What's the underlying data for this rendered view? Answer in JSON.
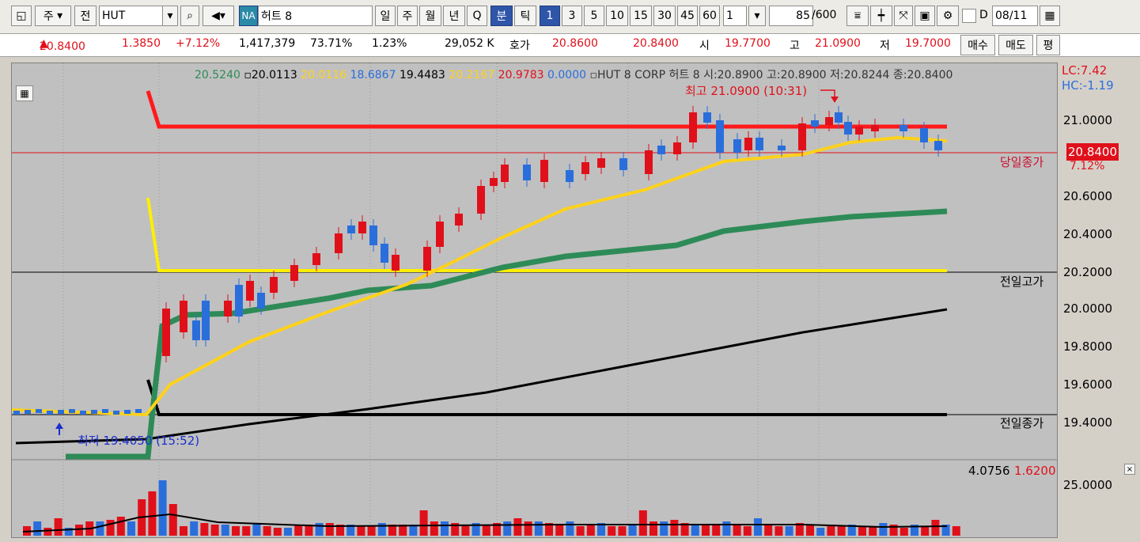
{
  "toolbar": {
    "period_label": "주",
    "prev_label": "전",
    "symbol": "HUT",
    "na_badge": "NA",
    "stock_name": "허트 8",
    "period_buttons": [
      "일",
      "주",
      "월",
      "년",
      "Q",
      "분",
      "틱"
    ],
    "minute_buttons": [
      "1",
      "3",
      "5",
      "10",
      "15",
      "30",
      "45",
      "60"
    ],
    "interval_value": "1",
    "count_value": "85",
    "count_total": "/600",
    "date_label": "D",
    "date_value": "08/11"
  },
  "quote": {
    "price": "20.8400",
    "change": "1.3850",
    "change_pct": "+7.12%",
    "volume": "1,417,379",
    "vol_ratio": "73.71%",
    "turnover": "1.23%",
    "amount": "29,052 K",
    "bidask_label": "호가",
    "ask": "20.8600",
    "bid": "20.8400",
    "open_label": "시",
    "open": "19.7700",
    "high_label": "고",
    "high": "21.0900",
    "low_label": "저",
    "low": "19.7000",
    "buy_label": "매수",
    "sell_label": "매도",
    "eval_label": "평"
  },
  "legend": {
    "v1": "20.5240",
    "v2": "20.0113",
    "v3": "20.0116",
    "v4": "18.6867",
    "v5": "19.4483",
    "v6": "20.2167",
    "v7": "20.9783",
    "v8": "0.0000",
    "info": "HUT 8 CORP  허트 8 시:20.8900 고:20.8900 저:20.8244 종:20.8400",
    "lc": "LC:7.42",
    "hc": "HC:-1.19"
  },
  "annotations": {
    "high": "최고 21.0900 (10:31)",
    "low": "최저 19.4050 (15:52)",
    "today_close": "당일종가",
    "today_close_value": "20.8400",
    "today_close_pct": "7.12%",
    "prev_high": "전일고가",
    "prev_close": "전일종가"
  },
  "axis": {
    "price_ticks": [
      "21.0000",
      "20.6000",
      "20.4000",
      "20.2000",
      "20.0000",
      "19.8000",
      "19.6000",
      "19.4000"
    ],
    "volume_tick": "25.0000",
    "volume_readout": "4.0756",
    "volume_readout2": "1.6200"
  },
  "colors": {
    "up": "#e0101a",
    "down": "#2a6edc",
    "ma_green": "#2e8b57",
    "ma_yellow": "#ffd21a",
    "ma_black": "#000000"
  }
}
